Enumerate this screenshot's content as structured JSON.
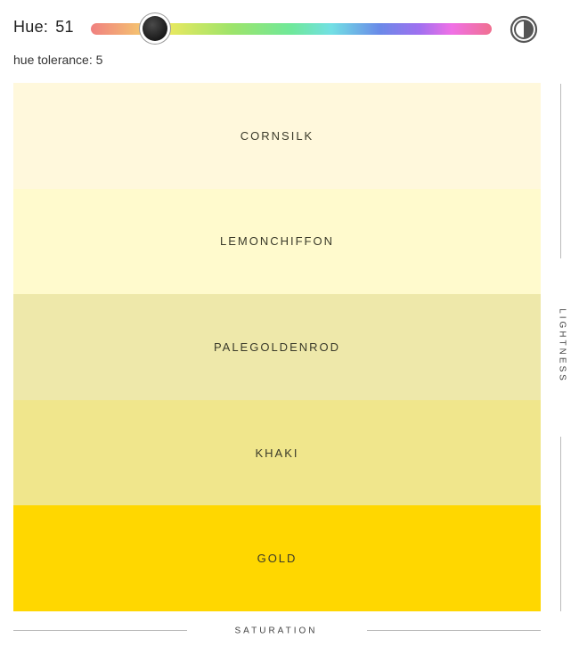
{
  "hue": {
    "label": "Hue:",
    "value": "51",
    "slider_value": 51,
    "slider_max": 360
  },
  "tolerance": {
    "text": "hue tolerance: 5"
  },
  "contrast_toggle": {
    "icon": "contrast-icon"
  },
  "swatches": [
    {
      "name": "CORNSILK",
      "color": "#fff8dc"
    },
    {
      "name": "LEMONCHIFFON",
      "color": "#fffacd"
    },
    {
      "name": "PALEGOLDENROD",
      "color": "#eee8aa"
    },
    {
      "name": "KHAKI",
      "color": "#f0e68c"
    },
    {
      "name": "GOLD",
      "color": "#ffd700"
    }
  ],
  "axes": {
    "vertical_label": "LIGHTNESS",
    "horizontal_label": "SATURATION"
  }
}
